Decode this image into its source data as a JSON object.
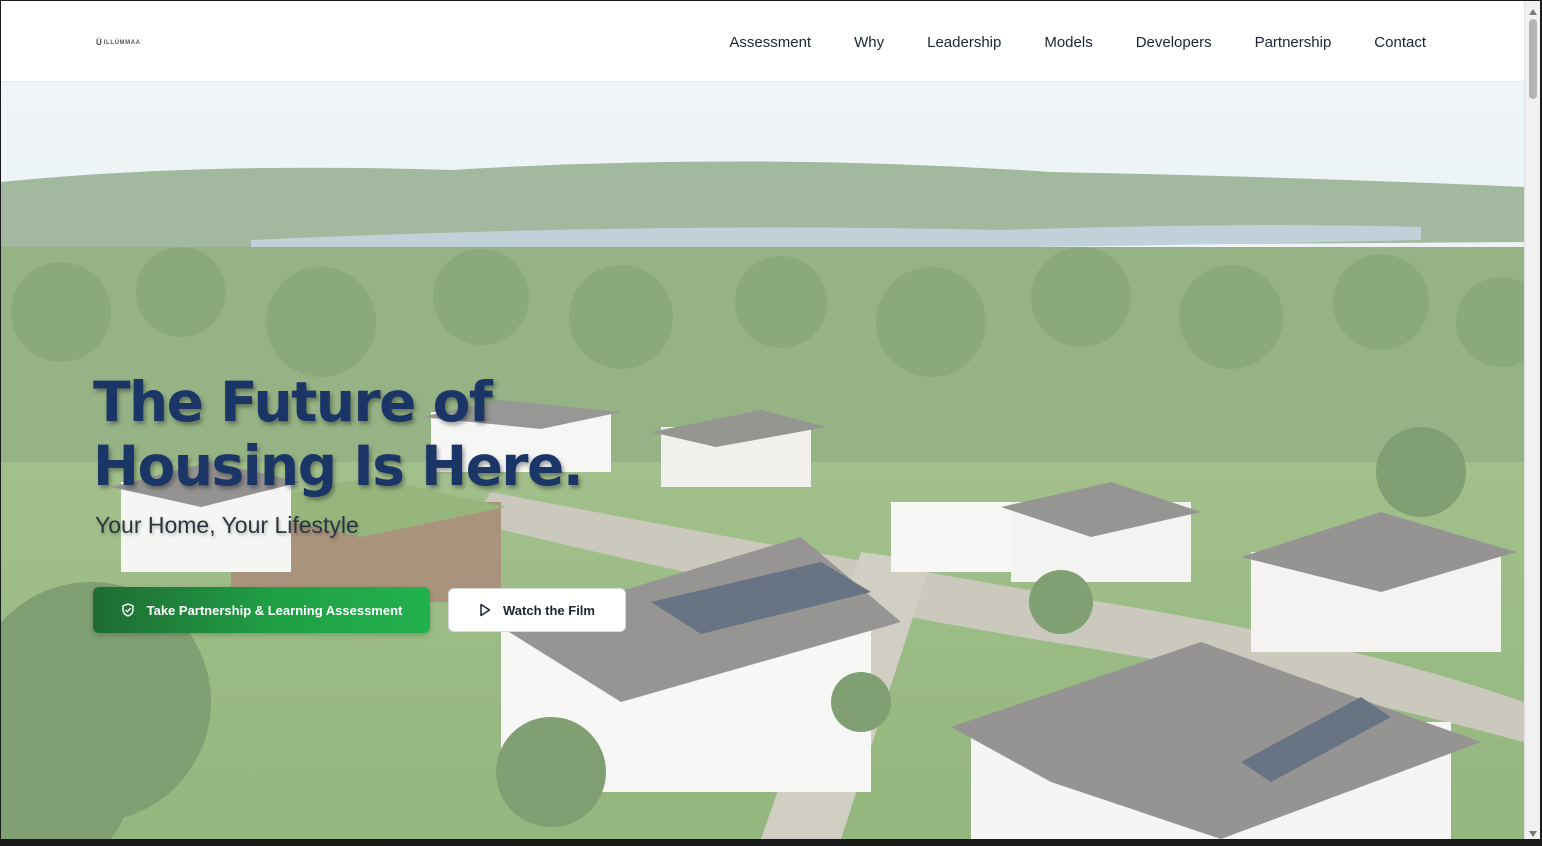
{
  "brand": {
    "mark": "Ü",
    "name": "ILLÜMMAA"
  },
  "nav": {
    "items": [
      {
        "label": "Assessment"
      },
      {
        "label": "Why"
      },
      {
        "label": "Leadership"
      },
      {
        "label": "Models"
      },
      {
        "label": "Developers"
      },
      {
        "label": "Partnership"
      },
      {
        "label": "Contact"
      }
    ]
  },
  "hero": {
    "headline_line1": "The Future of",
    "headline_line2": "Housing Is Here.",
    "subheadline": "Your Home, Your Lifestyle",
    "primary_cta": "Take Partnership & Learning Assessment",
    "secondary_cta": "Watch the Film",
    "image_description": "aerial-neighborhood-modern-homes-solar-panels-lake"
  },
  "colors": {
    "headline": "#1b3567",
    "primary_cta_start": "#1f6b33",
    "primary_cta_end": "#22b14d",
    "nav_text": "#1d2433"
  },
  "icons": {
    "primary_cta": "handshake-shield-icon",
    "secondary_cta": "play-icon"
  }
}
